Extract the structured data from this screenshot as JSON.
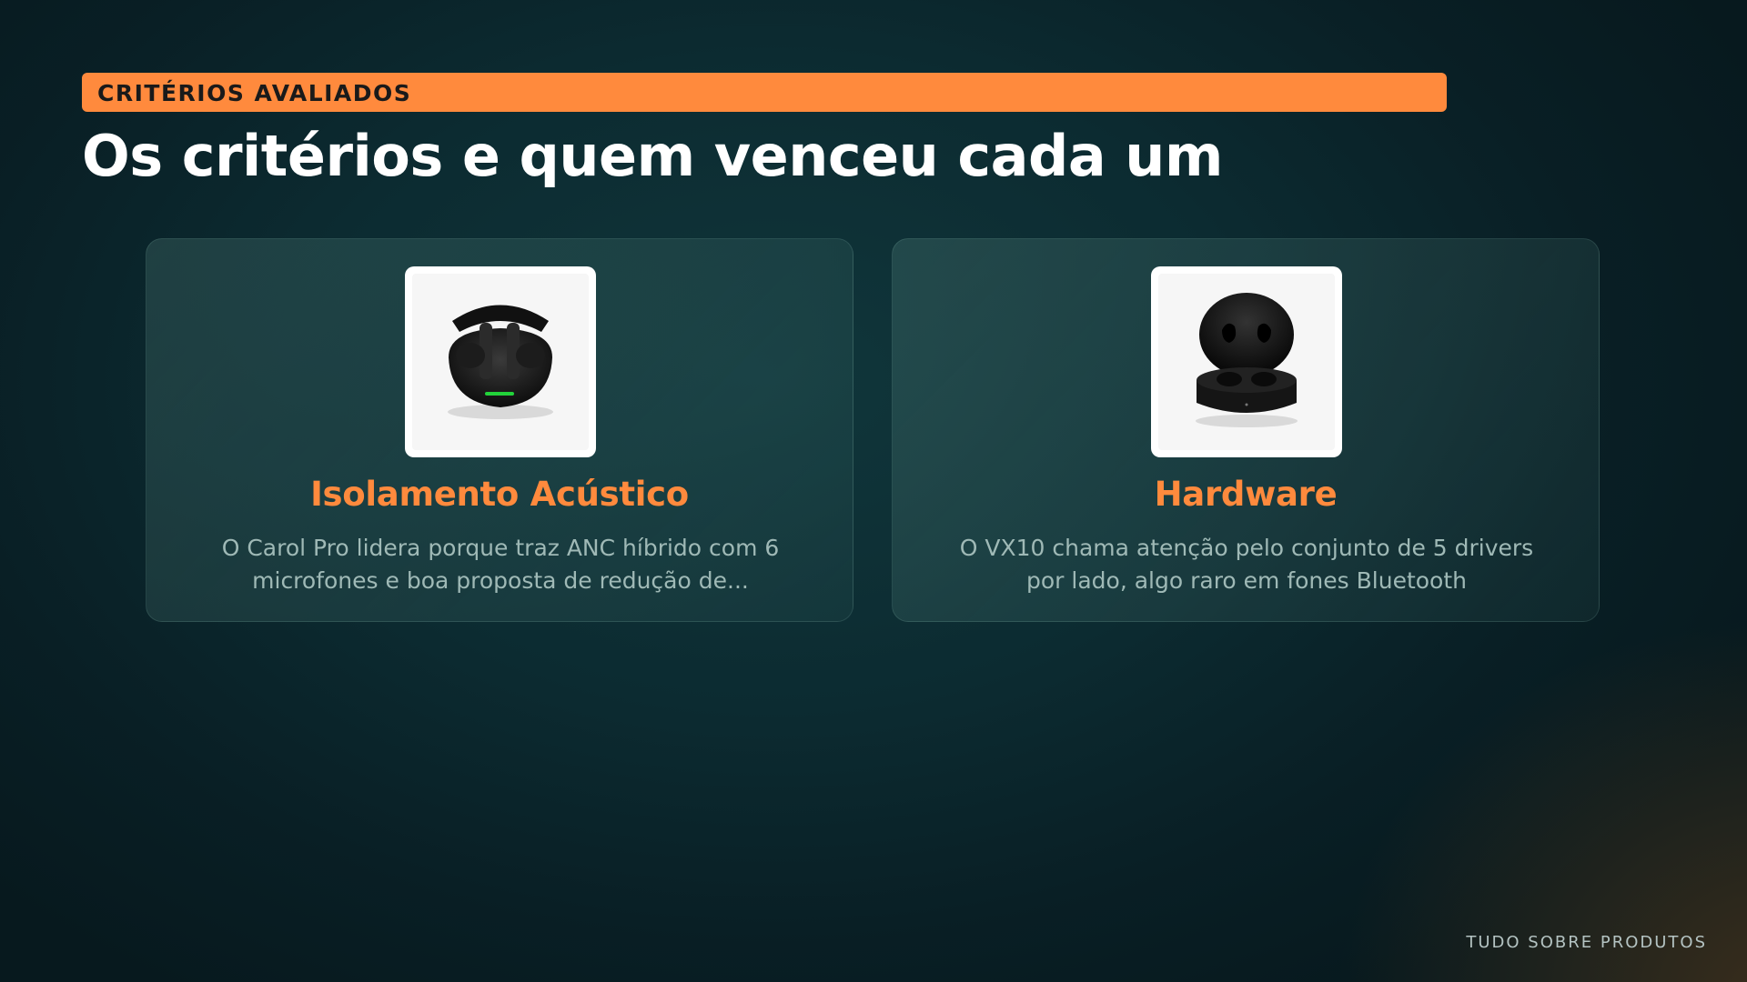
{
  "header": {
    "tag": "CRITÉRIOS AVALIADOS",
    "title": "Os critérios e quem venceu cada um"
  },
  "cards": [
    {
      "title": "Isolamento Acústico",
      "description": "O Carol Pro lidera porque traz ANC híbrido com 6 microfones e boa proposta de redução de...",
      "icon": "earbuds-case-open-image"
    },
    {
      "title": "Hardware",
      "description": "O VX10 chama atenção pelo conjunto de 5 drivers por lado, algo raro em fones Bluetooth",
      "icon": "earbuds-round-case-image"
    }
  ],
  "footer": {
    "brand": "TUDO SOBRE PRODUTOS"
  },
  "colors": {
    "accent": "#ff8a3d",
    "background": "#0c2b31",
    "card_text": "#9fb9b6"
  }
}
